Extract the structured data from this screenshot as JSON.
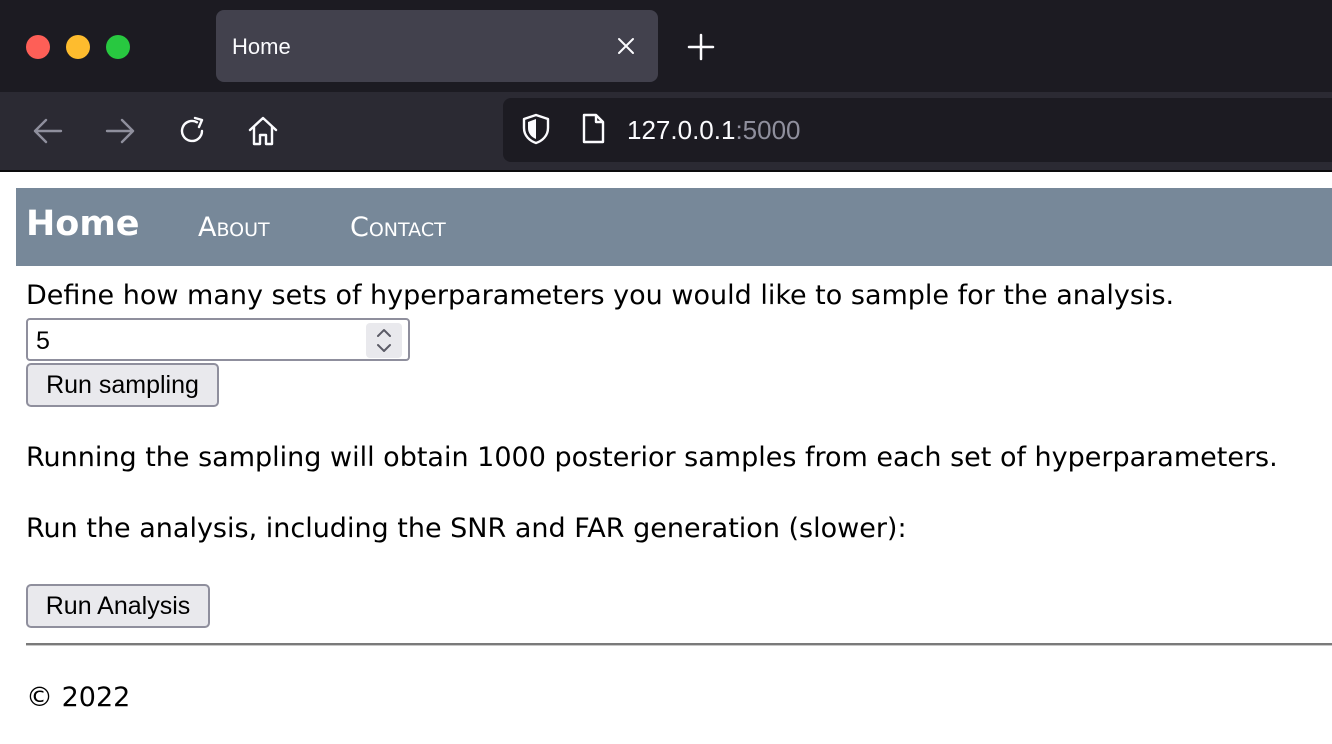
{
  "browser": {
    "tab_title": "Home",
    "url_host": "127.0.0.1",
    "url_port": ":5000"
  },
  "site_nav": {
    "brand": "Home",
    "links": [
      "About",
      "Contact"
    ]
  },
  "sampling": {
    "prompt": "Define how many sets of hyperparameters you would like to sample for the analysis.",
    "value": "5",
    "button_label": "Run sampling",
    "note": "Running the sampling will obtain 1000 posterior samples from each set of hyperparameters."
  },
  "analysis": {
    "prompt": "Run the analysis, including the SNR and FAR generation (slower):",
    "button_label": "Run Analysis"
  },
  "footer": {
    "text": "© 2022"
  },
  "icons": [
    "back-arrow-icon",
    "forward-arrow-icon",
    "reload-icon",
    "home-icon",
    "shield-icon",
    "page-icon",
    "close-icon",
    "plus-icon",
    "spinner-up-icon",
    "spinner-down-icon"
  ]
}
